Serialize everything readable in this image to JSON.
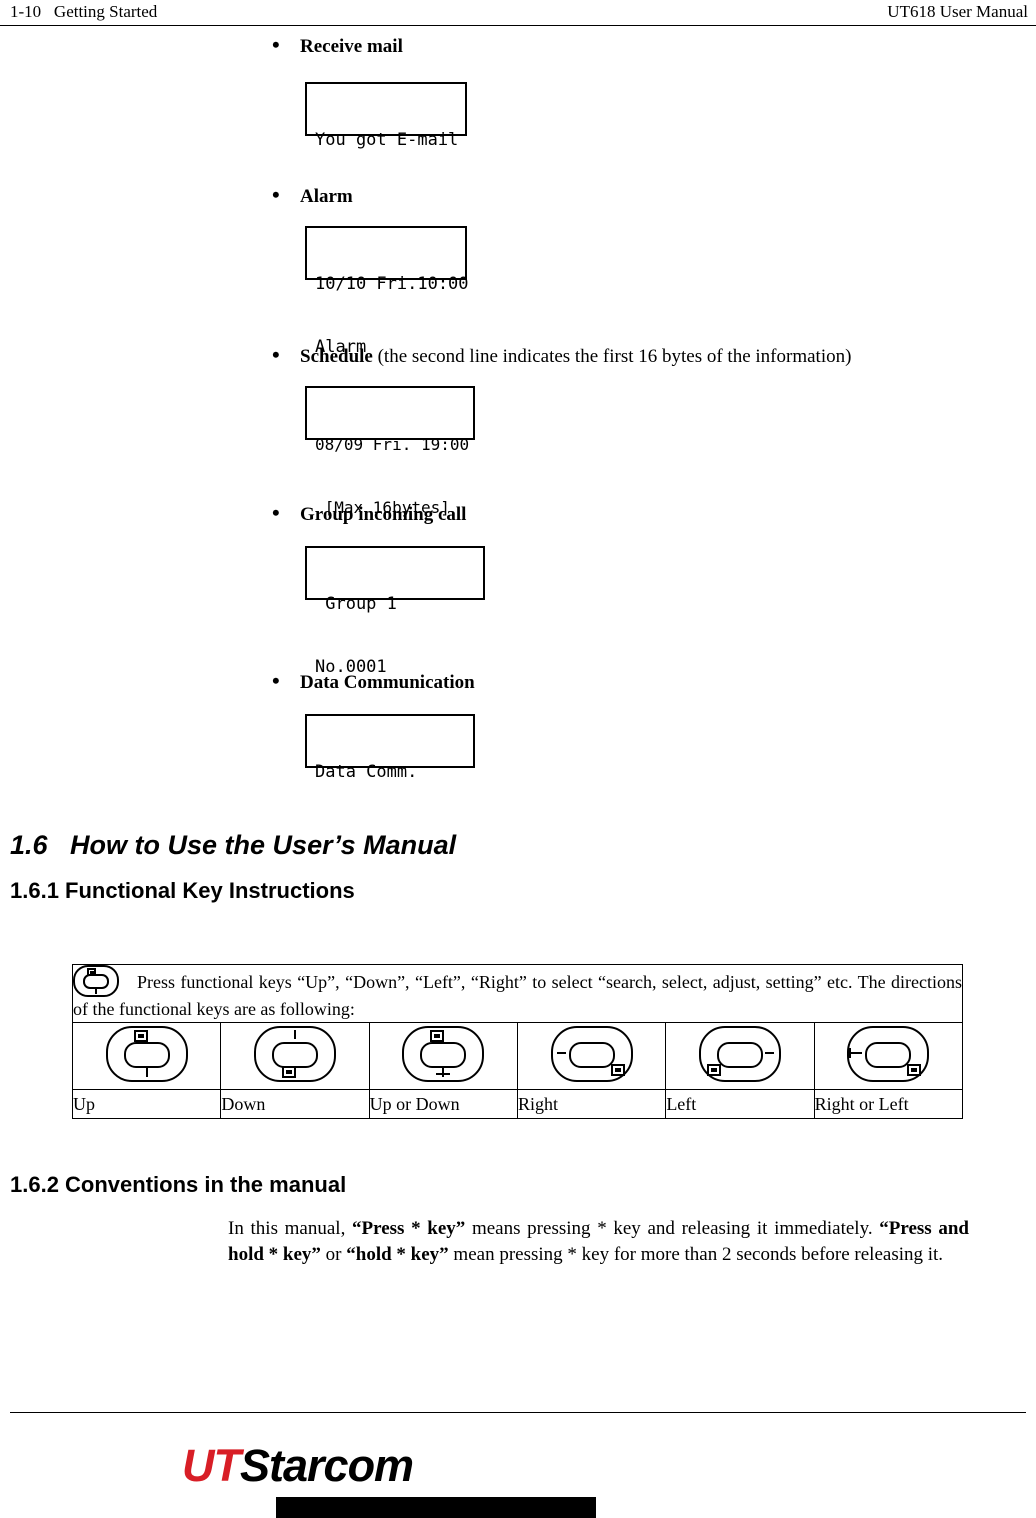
{
  "header": {
    "left": "1-10   Getting Started",
    "right": "UT618 User Manual"
  },
  "bullets": [
    {
      "label": "Receive mail",
      "note": "",
      "lcd": {
        "line1": "You got E-mail",
        "line2": ""
      }
    },
    {
      "label": "Alarm",
      "note": "",
      "lcd": {
        "line1": "10/10 Fri.10:00",
        "line2": "Alarm"
      }
    },
    {
      "label": "Schedule",
      "note": " (the second line indicates the first 16 bytes of the information)",
      "lcd": {
        "line1": "08/09 Fri. 19:00",
        "line2": " [Max 16bytes]"
      }
    },
    {
      "label": "Group incoming call",
      "note": "",
      "lcd": {
        "line1": " Group 1",
        "line2": "No.0001"
      }
    },
    {
      "label": "Data Communication",
      "note": "",
      "lcd": {
        "line1": "Data Comm.",
        "line2": ""
      }
    }
  ],
  "sections": {
    "s16_title": "1.6   How to Use the User’s Manual",
    "s161_title": "1.6.1 Functional Key Instructions",
    "s162_title": "1.6.2 Conventions in the manual"
  },
  "key_table": {
    "intro": "Press functional keys “Up”, “Down”, “Left”, “Right” to select “search, select, adjust, setting” etc. The directions of the functional keys are as following:",
    "labels": [
      "Up",
      "Down",
      "Up or Down",
      "Right",
      "Left",
      "Right or Left"
    ]
  },
  "conventions": {
    "p1_a": "In this manual, ",
    "p1_b": "“Press * key”",
    "p1_c": " means pressing * key and releasing it immediately.  ",
    "p1_d": "“Press and hold * key”",
    "p1_e": " or ",
    "p1_f": "“hold * key”",
    "p1_g": " mean pressing * key for more than 2 seconds before releasing it."
  },
  "footer": {
    "logo_ut": "UT",
    "logo_starcom": "Starcom"
  }
}
